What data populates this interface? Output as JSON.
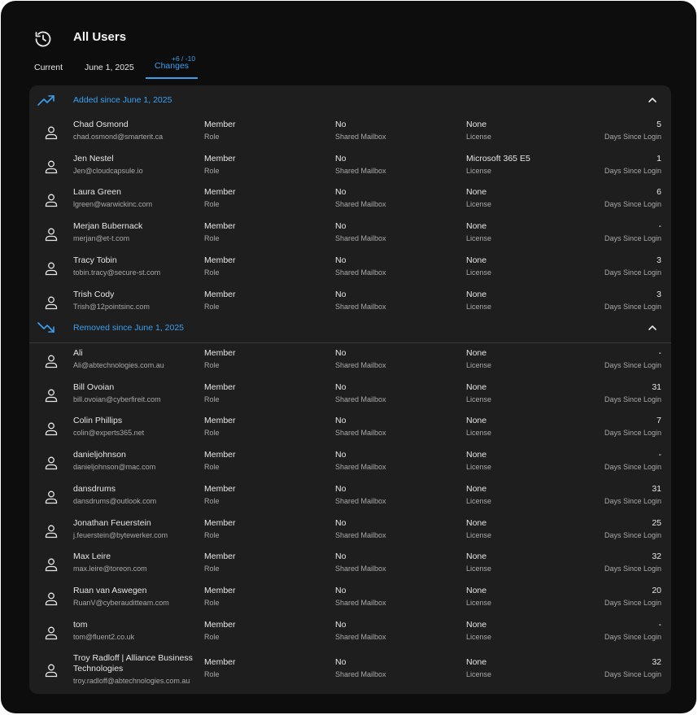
{
  "header": {
    "title": "All Users",
    "icon": "history-icon"
  },
  "tabs": [
    {
      "label": "Current",
      "active": false
    },
    {
      "label": "June 1, 2025",
      "active": false
    },
    {
      "label": "Changes",
      "badge": "+6 / -10",
      "active": true
    }
  ],
  "labels": {
    "role": "Role",
    "mailbox": "Shared Mailbox",
    "license": "License",
    "days": "Days Since Login"
  },
  "colors": {
    "accent": "#3aa0f0",
    "background": "#0d0d0d",
    "panel": "#1e1e1e"
  },
  "added": {
    "title": "Added since June 1, 2025",
    "icon": "trending-up-icon",
    "rows": [
      {
        "name": "Chad Osmond",
        "email": "chad.osmond@smarterit.ca",
        "role": "Member",
        "mailbox": "No",
        "license": "None",
        "days": "5"
      },
      {
        "name": "Jen Nestel",
        "email": "Jen@cloudcapsule.io",
        "role": "Member",
        "mailbox": "No",
        "license": "Microsoft 365 E5",
        "days": "1"
      },
      {
        "name": "Laura Green",
        "email": "lgreen@warwickinc.com",
        "role": "Member",
        "mailbox": "No",
        "license": "None",
        "days": "6"
      },
      {
        "name": "Merjan Bubernack",
        "email": "merjan@et-t.com",
        "role": "Member",
        "mailbox": "No",
        "license": "None",
        "days": "-"
      },
      {
        "name": "Tracy Tobin",
        "email": "tobin.tracy@secure-st.com",
        "role": "Member",
        "mailbox": "No",
        "license": "None",
        "days": "3"
      },
      {
        "name": "Trish Cody",
        "email": "Trish@12pointsinc.com",
        "role": "Member",
        "mailbox": "No",
        "license": "None",
        "days": "3"
      }
    ]
  },
  "removed": {
    "title": "Removed since June 1, 2025",
    "icon": "trending-down-icon",
    "rows": [
      {
        "name": "Ali",
        "email": "Ali@abtechnologies.com.au",
        "role": "Member",
        "mailbox": "No",
        "license": "None",
        "days": "-"
      },
      {
        "name": "Bill Ovoian",
        "email": "bill.ovoian@cyberfireit.com",
        "role": "Member",
        "mailbox": "No",
        "license": "None",
        "days": "31"
      },
      {
        "name": "Colin Phillips",
        "email": "colin@experts365.net",
        "role": "Member",
        "mailbox": "No",
        "license": "None",
        "days": "7"
      },
      {
        "name": "danieljohnson",
        "email": "danieljohnson@mac.com",
        "role": "Member",
        "mailbox": "No",
        "license": "None",
        "days": "-"
      },
      {
        "name": "dansdrums",
        "email": "dansdrums@outlook.com",
        "role": "Member",
        "mailbox": "No",
        "license": "None",
        "days": "31"
      },
      {
        "name": "Jonathan Feuerstein",
        "email": "j.feuerstein@bytewerker.com",
        "role": "Member",
        "mailbox": "No",
        "license": "None",
        "days": "25"
      },
      {
        "name": "Max Leire",
        "email": "max.leire@toreon.com",
        "role": "Member",
        "mailbox": "No",
        "license": "None",
        "days": "32"
      },
      {
        "name": "Ruan van Aswegen",
        "email": "RuanV@cyberauditteam.com",
        "role": "Member",
        "mailbox": "No",
        "license": "None",
        "days": "20"
      },
      {
        "name": "tom",
        "email": "tom@fluent2.co.uk",
        "role": "Member",
        "mailbox": "No",
        "license": "None",
        "days": "-"
      },
      {
        "name": "Troy Radloff | Alliance Business Technologies",
        "email": "troy.radloff@abtechnologies.com.au",
        "role": "Member",
        "mailbox": "No",
        "license": "None",
        "days": "32"
      }
    ]
  }
}
